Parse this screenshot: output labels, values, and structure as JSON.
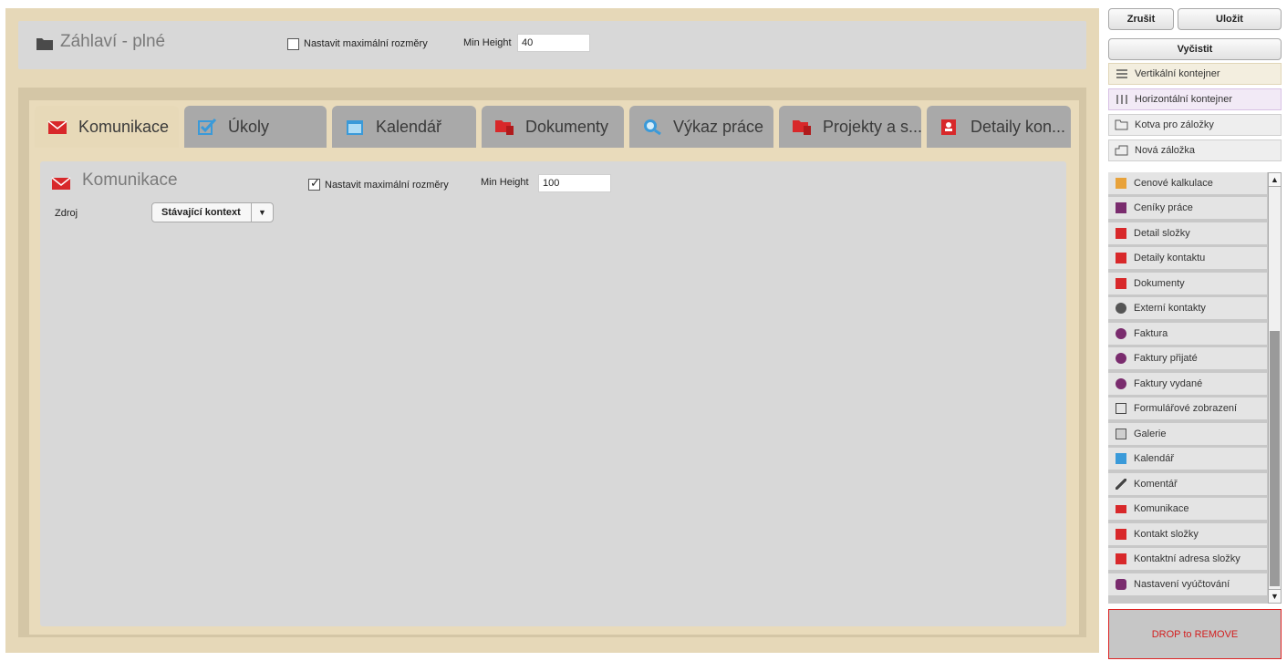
{
  "header_panel": {
    "title": "Záhlaví - plné",
    "checkbox_label": "Nastavit maximální rozměry",
    "checkbox_checked": false,
    "min_height_label": "Min Height",
    "min_height_value": "40"
  },
  "tabs": [
    {
      "label": "Komunikace",
      "icon": "envelope-icon",
      "active": true
    },
    {
      "label": "Úkoly",
      "icon": "checkbox-icon",
      "active": false
    },
    {
      "label": "Kalendář",
      "icon": "calendar-icon",
      "active": false
    },
    {
      "label": "Dokumenty",
      "icon": "documents-icon",
      "active": false
    },
    {
      "label": "Výkaz práce",
      "icon": "clock-search-icon",
      "active": false
    },
    {
      "label": "Projekty a s...",
      "icon": "project-folder-icon",
      "active": false
    },
    {
      "label": "Detaily kon...",
      "icon": "contact-card-icon",
      "active": false
    }
  ],
  "content_panel": {
    "title": "Komunikace",
    "checkbox_label": "Nastavit maximální rozměry",
    "checkbox_checked": true,
    "min_height_label": "Min Height",
    "min_height_value": "100",
    "source_label": "Zdroj",
    "source_value": "Stávající kontext"
  },
  "toolbar": {
    "cancel": "Zrušit",
    "save": "Uložit",
    "clear": "Vyčistit"
  },
  "containers": [
    {
      "label": "Vertikální kontejner",
      "icon": "lines-icon"
    },
    {
      "label": "Horizontální kontejner",
      "icon": "columns-icon"
    },
    {
      "label": "Kotva pro záložky",
      "icon": "folder-outline-icon"
    },
    {
      "label": "Nová záložka",
      "icon": "tab-outline-icon"
    }
  ],
  "widgets": [
    {
      "label": "Cenové kalkulace",
      "icon": "calculator-icon",
      "color": "#e8a23a"
    },
    {
      "label": "Ceníky práce",
      "icon": "pricelist-icon",
      "color": "#7a2c6e"
    },
    {
      "label": "Detail složky",
      "icon": "contact-card-icon",
      "color": "#d8282a"
    },
    {
      "label": "Detaily kontaktu",
      "icon": "contact-card-icon",
      "color": "#d8282a"
    },
    {
      "label": "Dokumenty",
      "icon": "documents-icon",
      "color": "#d8282a"
    },
    {
      "label": "Externí kontakty",
      "icon": "person-add-icon",
      "color": "#555555"
    },
    {
      "label": "Faktura",
      "icon": "invoice-icon",
      "color": "#7a2c6e"
    },
    {
      "label": "Faktury přijaté",
      "icon": "invoice-icon",
      "color": "#7a2c6e"
    },
    {
      "label": "Faktury vydané",
      "icon": "invoice-icon",
      "color": "#7a2c6e"
    },
    {
      "label": "Formulářové zobrazení",
      "icon": "form-edit-icon",
      "color": "#444444"
    },
    {
      "label": "Galerie",
      "icon": "gallery-icon",
      "color": "#555555"
    },
    {
      "label": "Kalendář",
      "icon": "calendar-icon",
      "color": "#3a9ad9"
    },
    {
      "label": "Komentář",
      "icon": "pencil-icon",
      "color": "#444444"
    },
    {
      "label": "Komunikace",
      "icon": "envelope-icon",
      "color": "#d8282a"
    },
    {
      "label": "Kontakt složky",
      "icon": "contact-card-icon",
      "color": "#d8282a"
    },
    {
      "label": "Kontaktní adresa složky",
      "icon": "contact-card-icon",
      "color": "#d8282a"
    },
    {
      "label": "Nastavení vyúčtování",
      "icon": "settings-billing-icon",
      "color": "#7a2c6e"
    }
  ],
  "drop_zone": "DROP to REMOVE",
  "colors": {
    "canvas_bg": "#e6d8b8",
    "panel_bg": "#d8d8d8",
    "tab_inactive": "#a9a9a9",
    "accent_red": "#d8282a",
    "accent_blue": "#3a9ad9"
  }
}
